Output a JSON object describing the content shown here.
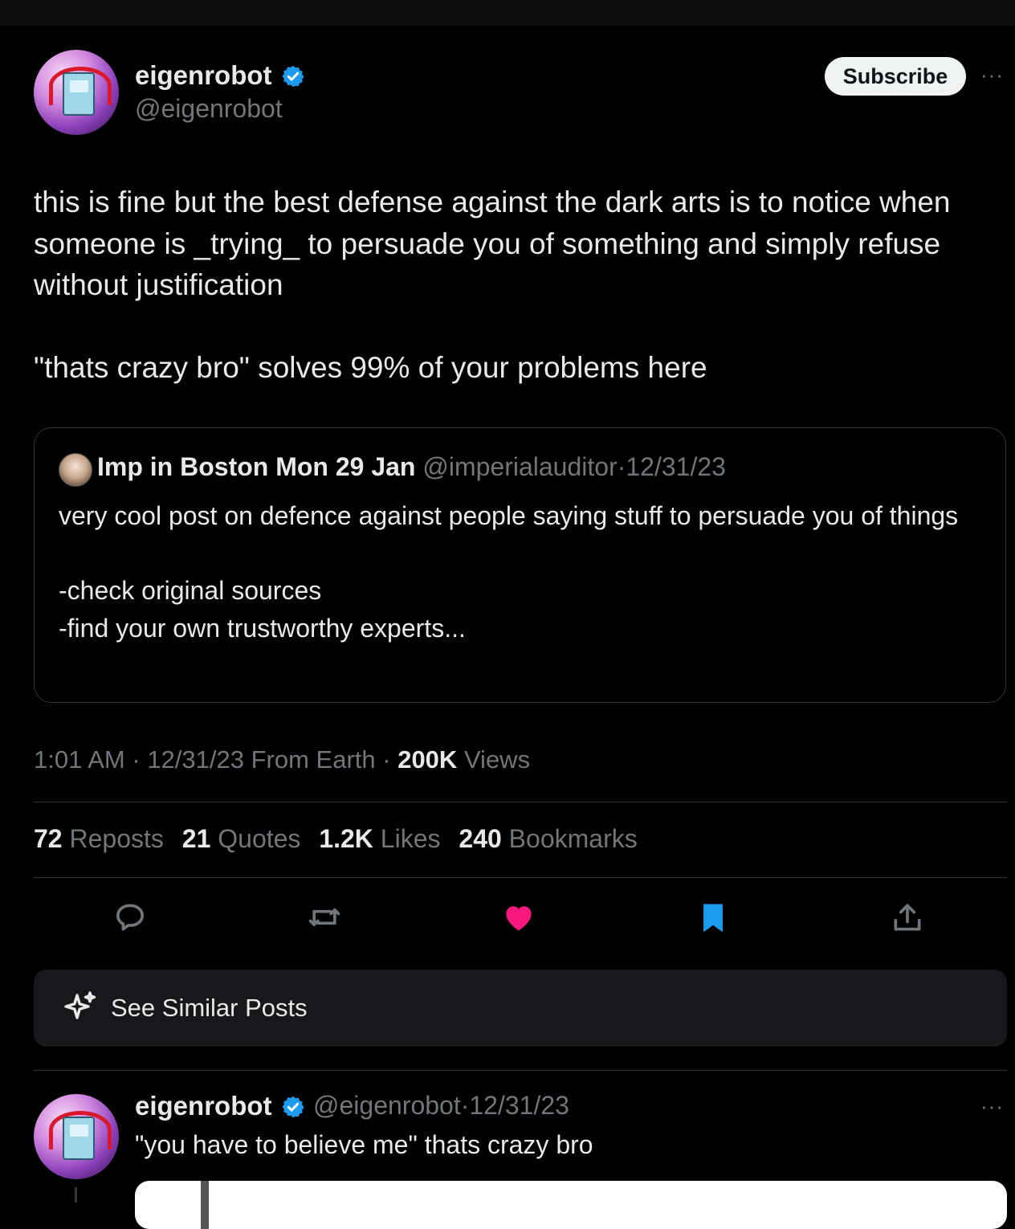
{
  "post": {
    "author_name": "eigenrobot",
    "author_handle": "@eigenrobot",
    "subscribe_label": "Subscribe",
    "more_label": "···",
    "text": "this is fine but the best defense against the dark arts is to notice when someone is _trying_ to persuade you of something and simply refuse without justification\n\n\"thats crazy bro\" solves 99% of your problems here",
    "quote": {
      "author_name": "Imp in Boston Mon 29 Jan",
      "author_handle": "@imperialauditor",
      "date": "12/31/23",
      "text": "very cool post on defence against people saying stuff to persuade you of things\n\n-check original sources\n-find your own trustworthy experts..."
    },
    "time": "1:01 AM",
    "date": "12/31/23",
    "source": "From Earth",
    "views_count": "200K",
    "views_label": "Views",
    "stats": [
      {
        "count": "72",
        "label": "Reposts"
      },
      {
        "count": "21",
        "label": "Quotes"
      },
      {
        "count": "1.2K",
        "label": "Likes"
      },
      {
        "count": "240",
        "label": "Bookmarks"
      }
    ],
    "actions": [
      "reply-icon",
      "repost-icon",
      "like-icon",
      "bookmark-icon",
      "share-icon"
    ]
  },
  "similar": {
    "label": "See Similar Posts",
    "icon": "sparkle-icon"
  },
  "reply": {
    "author_name": "eigenrobot",
    "author_handle": "@eigenrobot",
    "date": "12/31/23",
    "text": "\"you have to believe me\" thats crazy bro",
    "more_label": "···"
  },
  "colors": {
    "background": "#000000",
    "text": "#e7e9ea",
    "muted": "#71767b",
    "verified": "#1d9bf0",
    "like": "#f91880",
    "bookmark": "#1d9bf0",
    "card": "#16181c"
  }
}
